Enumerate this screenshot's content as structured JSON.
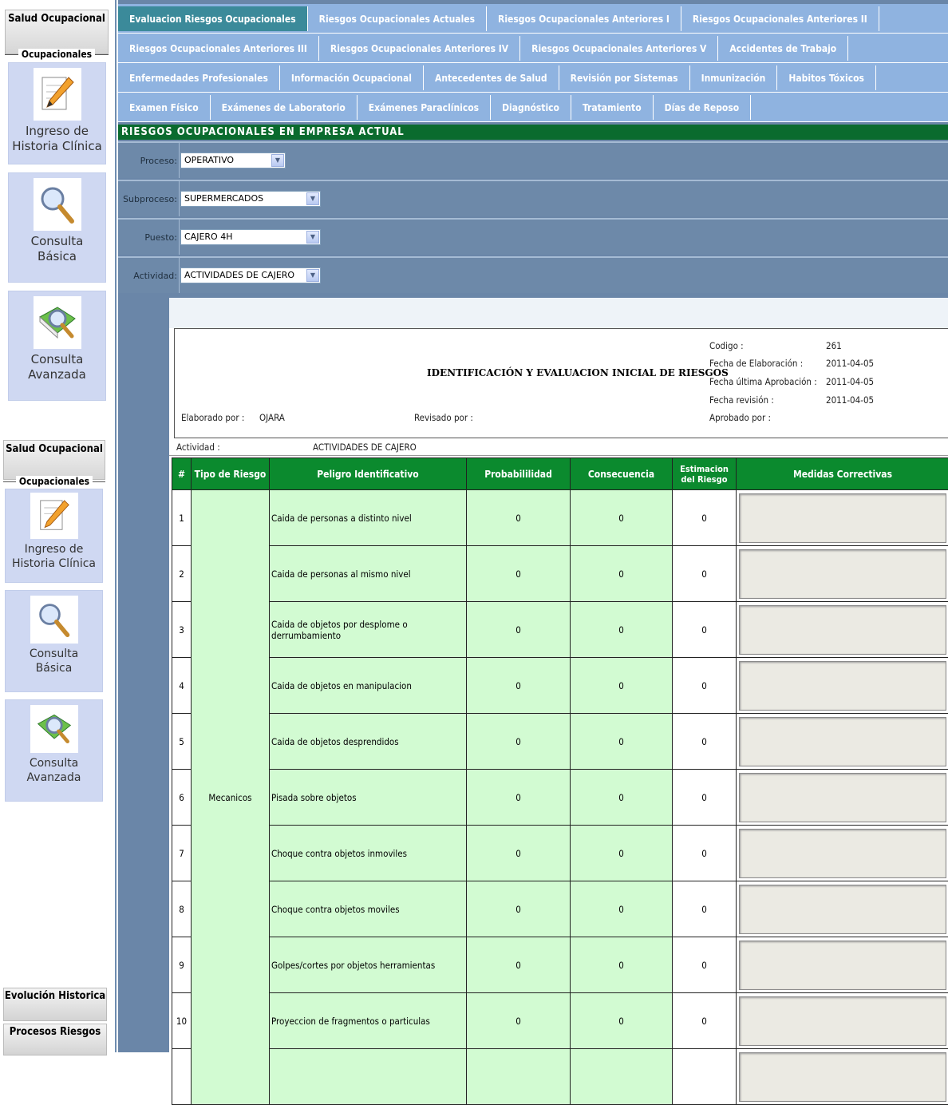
{
  "sidebar": {
    "group1": {
      "title": "Salud Ocupacional",
      "legend": "Ocupacionales"
    },
    "group2": {
      "title": "Salud Ocupacional",
      "legend": "Ocupacionales"
    },
    "buttons": [
      {
        "label": "Ingreso de Historia Clínica",
        "icon": "pencil-note-icon"
      },
      {
        "label": "Consulta Básica",
        "icon": "magnifier-icon"
      },
      {
        "label": "Consulta Avanzada",
        "icon": "book-magnifier-icon"
      }
    ],
    "bottom": [
      "Evolución Historica",
      "Procesos Riesgos"
    ]
  },
  "tabs": [
    [
      "Evaluacion Riesgos Ocupacionales",
      "Riesgos Ocupacionales Actuales",
      "Riesgos Ocupacionales Anteriores I",
      "Riesgos Ocupacionales Anteriores II"
    ],
    [
      "Riesgos Ocupacionales Anteriores III",
      "Riesgos Ocupacionales Anteriores IV",
      "Riesgos Ocupacionales Anteriores V",
      "Accidentes de Trabajo"
    ],
    [
      "Enfermedades Profesionales",
      "Información Ocupacional",
      "Antecedentes de Salud",
      "Revisión por Sistemas",
      "Inmunización",
      "Habitos Tóxicos"
    ],
    [
      "Examen Físico",
      "Exámenes de Laboratorio",
      "Exámenes Paraclínicos",
      "Diagnóstico",
      "Tratamiento",
      "Días de Reposo"
    ]
  ],
  "section_title": "RIESGOS OCUPACIONALES EN EMPRESA ACTUAL",
  "filters": [
    {
      "label": "Proceso:",
      "value": "OPERATIVO"
    },
    {
      "label": "Subproceso:",
      "value": "SUPERMERCADOS"
    },
    {
      "label": "Puesto:",
      "value": "CAJERO 4H"
    },
    {
      "label": "Actividad:",
      "value": "ACTIVIDADES DE CAJERO"
    }
  ],
  "doc": {
    "title": "IDENTIFICACIÓN Y EVALUACION INICIAL DE RIESGOS",
    "codigo_label": "Codigo :",
    "codigo": "261",
    "fecha_elab_label": "Fecha de Elaboración :",
    "fecha_elab": "2011-04-05",
    "fecha_aprob_label": "Fecha última Aprobación :",
    "fecha_aprob": "2011-04-05",
    "fecha_rev_label": "Fecha revisión :",
    "fecha_rev": "2011-04-05",
    "aprobado_label": "Aprobado por :",
    "elaborado_label": "Elaborado por :",
    "elaborado": "OJARA",
    "revisado_label": "Revisado por :"
  },
  "actividad_label": "Actividad :",
  "actividad": "ACTIVIDADES DE CAJERO",
  "table": {
    "headers": [
      "#",
      "Tipo de Riesgo",
      "Peligro Identificativo",
      "Probabililidad",
      "Consecuencia",
      "Estimacion del Riesgo",
      "Medidas Correctivas"
    ],
    "tipo": "Mecanicos",
    "rows": [
      {
        "n": "1",
        "peligro": "Caida de personas a distinto nivel",
        "prob": "0",
        "cons": "0",
        "est": "0"
      },
      {
        "n": "2",
        "peligro": "Caida de personas al mismo nivel",
        "prob": "0",
        "cons": "0",
        "est": "0"
      },
      {
        "n": "3",
        "peligro": "Caida de objetos por desplome o derrumbamiento",
        "prob": "0",
        "cons": "0",
        "est": "0"
      },
      {
        "n": "4",
        "peligro": "Caida de objetos en manipulacion",
        "prob": "0",
        "cons": "0",
        "est": "0"
      },
      {
        "n": "5",
        "peligro": "Caida de objetos desprendidos",
        "prob": "0",
        "cons": "0",
        "est": "0"
      },
      {
        "n": "6",
        "peligro": "Pisada sobre objetos",
        "prob": "0",
        "cons": "0",
        "est": "0"
      },
      {
        "n": "7",
        "peligro": "Choque contra objetos inmoviles",
        "prob": "0",
        "cons": "0",
        "est": "0"
      },
      {
        "n": "8",
        "peligro": "Choque contra objetos moviles",
        "prob": "0",
        "cons": "0",
        "est": "0"
      },
      {
        "n": "9",
        "peligro": "Golpes/cortes por objetos herramientas",
        "prob": "0",
        "cons": "0",
        "est": "0"
      },
      {
        "n": "10",
        "peligro": "Proyeccion de fragmentos o particulas",
        "prob": "0",
        "cons": "0",
        "est": "0"
      }
    ]
  }
}
